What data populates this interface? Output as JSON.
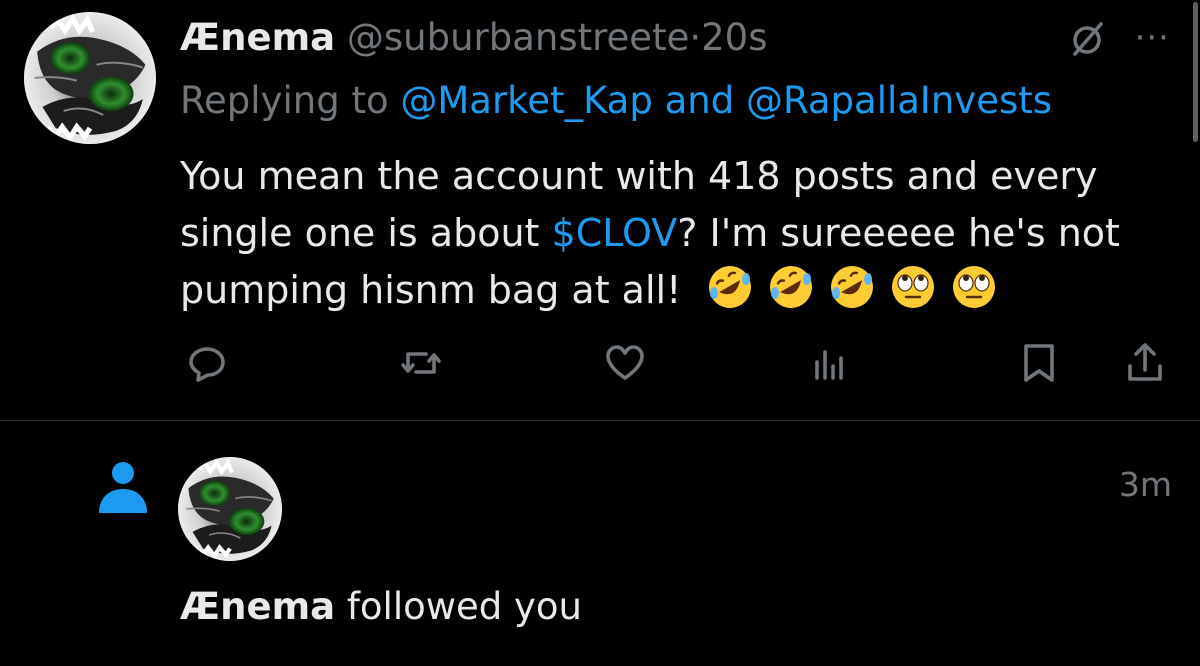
{
  "tweet": {
    "author_name": "Ænema",
    "author_handle": "@suburbanstreete",
    "separator": "·",
    "time": "20s",
    "more_label": "···",
    "replying_prefix": "Replying to",
    "replying_mentions": "@Market_Kap and @RapallaInvests",
    "body_part1": "You mean the account with 418 posts and every single one is about ",
    "cashtag": "$CLOV",
    "body_part2": "? I'm sureeeee he's not pumping hisnm bag at all! ",
    "emojis": [
      "rolling-on-floor-laughing",
      "rolling-on-floor-laughing",
      "rolling-on-floor-laughing",
      "face-with-rolling-eyes",
      "face-with-rolling-eyes"
    ],
    "actions": [
      "reply-icon",
      "retweet-icon",
      "like-icon",
      "views-icon",
      "bookmark-icon",
      "share-icon"
    ]
  },
  "notification": {
    "icon": "person-icon",
    "time": "3m",
    "actor_name": "Ænema",
    "action_text": " followed you"
  },
  "colors": {
    "background": "#000000",
    "text": "#e7e9ea",
    "muted": "#71767b",
    "accent": "#1d9bf0",
    "divider": "#2f3336"
  }
}
